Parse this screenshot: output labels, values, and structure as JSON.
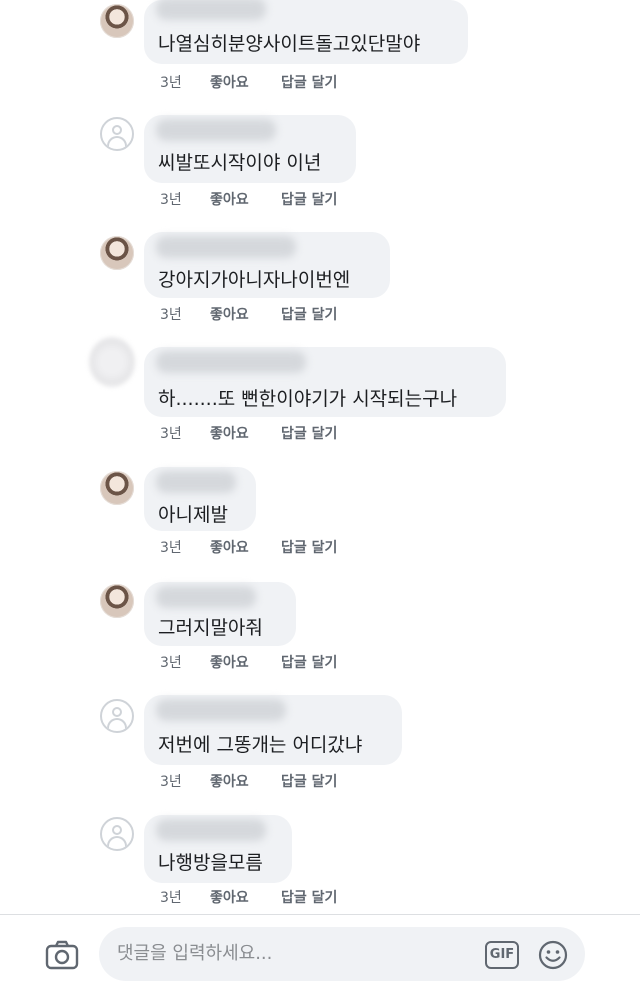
{
  "comments": [
    {
      "text": "나열심히분양사이트돌고있단말야",
      "time": "3년",
      "like": "좋아요",
      "reply": "답글 달기",
      "avatar": "photo"
    },
    {
      "text": "씨발또시작이야 이년",
      "time": "3년",
      "like": "좋아요",
      "reply": "답글 달기",
      "avatar": "default"
    },
    {
      "text": "강아지가아니자나이번엔",
      "time": "3년",
      "like": "좋아요",
      "reply": "답글 달기",
      "avatar": "photo"
    },
    {
      "text": "하.......또 뻔한이야기가 시작되는구나",
      "time": "3년",
      "like": "좋아요",
      "reply": "답글 달기",
      "avatar": "blurred"
    },
    {
      "text": "아니제발",
      "time": "3년",
      "like": "좋아요",
      "reply": "답글 달기",
      "avatar": "photo"
    },
    {
      "text": "그러지말아줘",
      "time": "3년",
      "like": "좋아요",
      "reply": "답글 달기",
      "avatar": "photo"
    },
    {
      "text": "저번에 그똥개는 어디갔냐",
      "time": "3년",
      "like": "좋아요",
      "reply": "답글 달기",
      "avatar": "default"
    },
    {
      "text": "나행방을모름",
      "time": "3년",
      "like": "좋아요",
      "reply": "답글 달기",
      "avatar": "default"
    }
  ],
  "composer": {
    "placeholder": "댓글을 입력하세요...",
    "gif_label": "GIF",
    "icons": [
      "camera-icon",
      "gif-icon",
      "emoji-icon"
    ]
  },
  "colors": {
    "bubble": "#f0f2f5",
    "meta_text": "#606770",
    "body_text": "#1c1e21"
  }
}
